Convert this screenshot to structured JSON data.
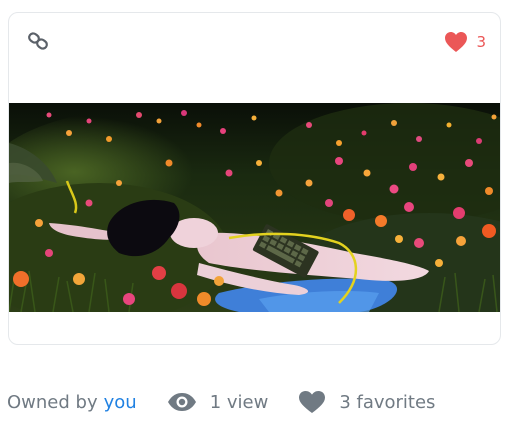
{
  "asset": {
    "favorite_count": "3"
  },
  "footer": {
    "owned_by_prefix": "Owned by",
    "owner_name": "you",
    "views_text": "1 view",
    "favorites_text": "3 favorites"
  },
  "colors": {
    "heart_red": "#eb5757",
    "link_blue": "#2081e2",
    "muted_gray": "#707a83",
    "card_border": "#e5e8eb"
  },
  "icons": {
    "chain": "chain-link-icon",
    "favorite": "heart-filled-icon",
    "views": "eye-icon",
    "favorites": "heart-icon"
  },
  "image": {
    "alt": "Woman lying in a flower meadow at night holding a keyboard"
  }
}
